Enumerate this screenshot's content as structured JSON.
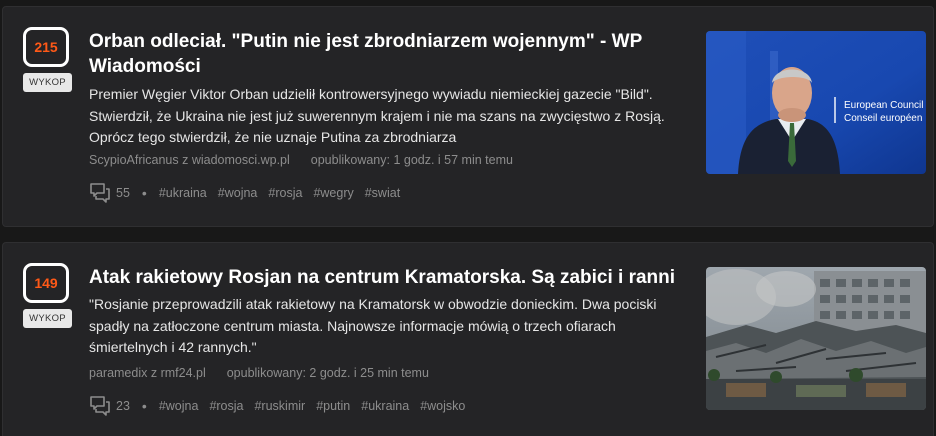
{
  "colors": {
    "page_bg": "#181818",
    "card_bg": "#242426",
    "vote_number": "#ff5917",
    "vote_border": "#ffffff",
    "meta_text": "#8d8d8d"
  },
  "entries": [
    {
      "votes": "215",
      "vote_button": "WYKOP",
      "title": "Orban odleciał. \"Putin nie jest zbrodniarzem wojennym\" - WP Wiadomości",
      "description": "Premier Węgier Viktor Orban udzielił kontrowersyjnego wywiadu niemieckiej gazecie \"Bild\". Stwierdził, że Ukraina nie jest już suwerennym krajem i nie ma szans na zwycięstwo z Rosją. Oprócz tego stwierdził, że nie uznaje Putina za zbrodniarza",
      "author": "ScypioAfricanus",
      "source": "z wiadomosci.wp.pl",
      "published": "opublikowany: 1 godz. i 57 min temu",
      "comments": "55",
      "comment_icon": "comment-icon",
      "tags": [
        "#ukraina",
        "#wojna",
        "#rosja",
        "#wegry",
        "#swiat"
      ],
      "thumbnail": {
        "icon": "news-photo-orban-eu-backdrop",
        "sign_line1": "European Council",
        "sign_line2": "Conseil européen"
      }
    },
    {
      "votes": "149",
      "vote_button": "WYKOP",
      "title": "Atak rakietowy Rosjan na centrum Kramatorska. Są zabici i ranni",
      "description": "\"Rosjanie przeprowadzili atak rakietowy na Kramatorsk w obwodzie donieckim. Dwa pociski spadły na zatłoczone centrum miasta. Najnowsze informacje mówią o trzech ofiarach śmiertelnych i 42 rannych.\"",
      "author": "paramedix",
      "source": "z rmf24.pl",
      "published": "opublikowany: 2 godz. i 25 min temu",
      "comments": "23",
      "comment_icon": "comment-icon",
      "tags": [
        "#wojna",
        "#rosja",
        "#ruskimir",
        "#putin",
        "#ukraina",
        "#wojsko"
      ],
      "thumbnail": {
        "icon": "news-photo-destroyed-buildings"
      }
    }
  ]
}
